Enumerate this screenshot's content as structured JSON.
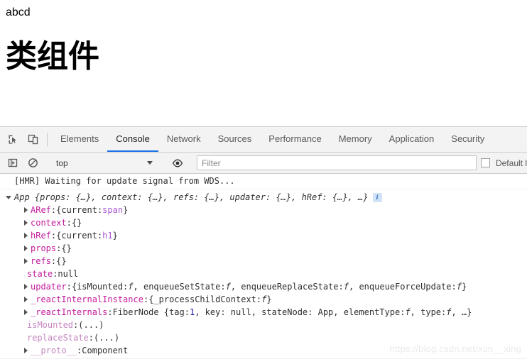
{
  "page": {
    "span_text": "abcd",
    "heading": "类组件"
  },
  "devtools": {
    "toolbar_icons": [
      {
        "name": "inspect-element-icon",
        "title": "Inspect element"
      },
      {
        "name": "device-toolbar-icon",
        "title": "Toggle device toolbar"
      }
    ],
    "tabs": [
      {
        "label": "Elements",
        "active": false
      },
      {
        "label": "Console",
        "active": true
      },
      {
        "label": "Network",
        "active": false
      },
      {
        "label": "Sources",
        "active": false
      },
      {
        "label": "Performance",
        "active": false
      },
      {
        "label": "Memory",
        "active": false
      },
      {
        "label": "Application",
        "active": false
      },
      {
        "label": "Security",
        "active": false
      }
    ],
    "active_tab": "Console",
    "accent_color": "#1a73e8",
    "filterbar": {
      "sidebar_toggle_icon": "console-sidebar-icon",
      "clear_icon": "clear-console-icon",
      "context_value": "top",
      "eye_icon": "live-expression-eye-icon",
      "filter_placeholder": "Filter",
      "filter_value": "",
      "levels_label": "Default l"
    }
  },
  "console": {
    "hmr_message": "[HMR] Waiting for update signal from WDS...",
    "object": {
      "header": "App {props: {…}, context: {…}, refs: {…}, updater: {…}, hRef: {…}, …}",
      "header_name": "App ",
      "header_body": "{props: {…}, context: {…}, refs: {…}, updater: {…}, hRef: {…}, …}",
      "info_badge": "i",
      "properties": [
        {
          "expandable": true,
          "name": "ARef",
          "sep": ": ",
          "value_parts": [
            {
              "t": "{current: ",
              "c": "text"
            },
            {
              "t": "span",
              "c": "node"
            },
            {
              "t": "}",
              "c": "text"
            }
          ]
        },
        {
          "expandable": true,
          "name": "context",
          "sep": ": ",
          "value_parts": [
            {
              "t": "{}",
              "c": "text"
            }
          ]
        },
        {
          "expandable": true,
          "name": "hRef",
          "sep": ": ",
          "value_parts": [
            {
              "t": "{current: ",
              "c": "text"
            },
            {
              "t": "h1",
              "c": "node"
            },
            {
              "t": "}",
              "c": "text"
            }
          ]
        },
        {
          "expandable": true,
          "name": "props",
          "sep": ": ",
          "value_parts": [
            {
              "t": "{}",
              "c": "text"
            }
          ]
        },
        {
          "expandable": true,
          "name": "refs",
          "sep": ": ",
          "value_parts": [
            {
              "t": "{}",
              "c": "text"
            }
          ]
        },
        {
          "expandable": false,
          "name": "state",
          "sep": ": ",
          "value_parts": [
            {
              "t": "null",
              "c": "text"
            }
          ]
        },
        {
          "expandable": true,
          "name": "updater",
          "sep": ": ",
          "value_parts": [
            {
              "t": "{isMounted: ",
              "c": "text"
            },
            {
              "t": "f",
              "c": "fn"
            },
            {
              "t": ", enqueueSetState: ",
              "c": "text"
            },
            {
              "t": "f",
              "c": "fn"
            },
            {
              "t": ", enqueueReplaceState: ",
              "c": "text"
            },
            {
              "t": "f",
              "c": "fn"
            },
            {
              "t": ", enqueueForceUpdate: ",
              "c": "text"
            },
            {
              "t": "f",
              "c": "fn"
            },
            {
              "t": "}",
              "c": "text"
            }
          ]
        },
        {
          "expandable": true,
          "name": "_reactInternalInstance",
          "sep": ": ",
          "value_parts": [
            {
              "t": "{_processChildContext: ",
              "c": "text"
            },
            {
              "t": "f",
              "c": "fn"
            },
            {
              "t": "}",
              "c": "text"
            }
          ]
        },
        {
          "expandable": true,
          "name": "_reactInternals",
          "sep": ": ",
          "value_parts": [
            {
              "t": "FiberNode {tag: ",
              "c": "text"
            },
            {
              "t": "1",
              "c": "num"
            },
            {
              "t": ", key: null, stateNode: App, elementType: ",
              "c": "text"
            },
            {
              "t": "f",
              "c": "fn"
            },
            {
              "t": ", type: ",
              "c": "text"
            },
            {
              "t": "f",
              "c": "fn"
            },
            {
              "t": ", …}",
              "c": "text"
            }
          ]
        },
        {
          "expandable": false,
          "dim": true,
          "name": "isMounted",
          "sep": ": ",
          "value_parts": [
            {
              "t": "(...)",
              "c": "text"
            }
          ]
        },
        {
          "expandable": false,
          "dim": true,
          "name": "replaceState",
          "sep": ": ",
          "value_parts": [
            {
              "t": "(...)",
              "c": "text"
            }
          ]
        },
        {
          "expandable": true,
          "dim": true,
          "name": "__proto__",
          "sep": ": ",
          "value_parts": [
            {
              "t": "Component",
              "c": "text"
            }
          ]
        }
      ]
    }
  },
  "watermark": "https://blog.csdn.net/xun__xing"
}
